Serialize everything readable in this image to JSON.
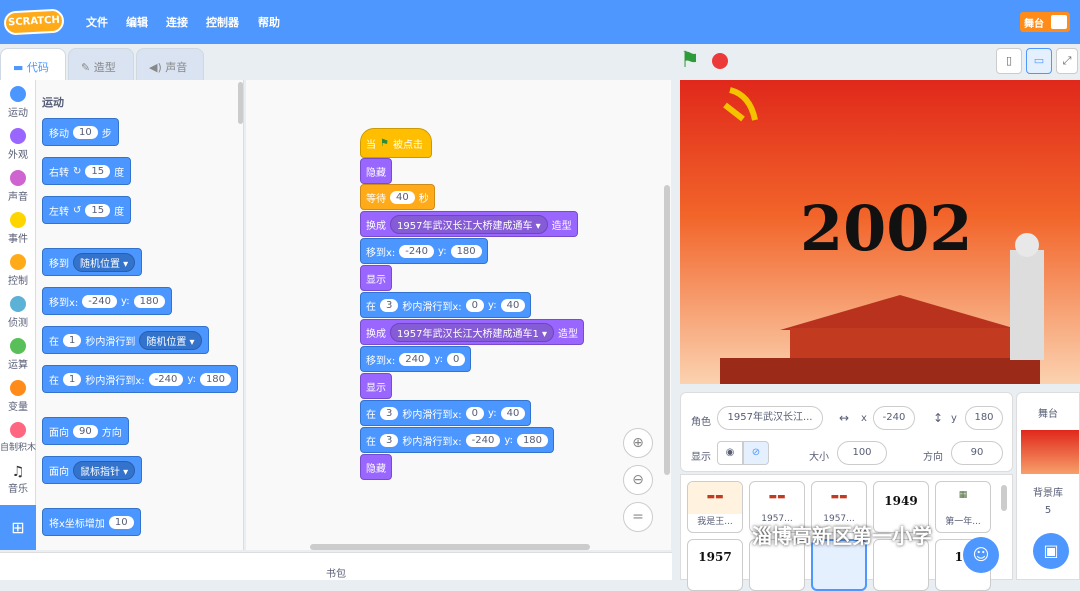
{
  "menu": {
    "logo_text": "SCRATCH",
    "items": [
      "文件",
      "编辑",
      "连接",
      "控制器",
      "帮助"
    ],
    "stage_toggle": "舞台"
  },
  "tabs": [
    "代码",
    "造型",
    "声音"
  ],
  "categories": [
    {
      "label": "运动",
      "color": "#4c97ff"
    },
    {
      "label": "外观",
      "color": "#9966ff"
    },
    {
      "label": "声音",
      "color": "#cf63cf"
    },
    {
      "label": "事件",
      "color": "#ffd500"
    },
    {
      "label": "控制",
      "color": "#ffab19"
    },
    {
      "label": "侦测",
      "color": "#5cb1d6"
    },
    {
      "label": "运算",
      "color": "#59c059"
    },
    {
      "label": "变量",
      "color": "#ff8c1a"
    },
    {
      "label": "自制积木",
      "color": "#ff6680"
    },
    {
      "label": "音乐",
      "color": ""
    }
  ],
  "palette": {
    "heading": "运动",
    "move": {
      "a": "移动",
      "v": "10",
      "b": "步"
    },
    "turn_right": {
      "a": "右转",
      "v": "15",
      "b": "度"
    },
    "turn_left": {
      "a": "左转",
      "v": "15",
      "b": "度"
    },
    "goto": {
      "a": "移到",
      "d": "随机位置"
    },
    "goto_xy": {
      "a": "移到x:",
      "x": "-240",
      "ylab": "y:",
      "y": "180"
    },
    "glide_to": {
      "a": "在",
      "v": "1",
      "b": "秒内滑行到",
      "d": "随机位置"
    },
    "glide_xy": {
      "a": "在",
      "v": "1",
      "b": "秒内滑行到x:",
      "x": "-240",
      "ylab": "y:",
      "y": "180"
    },
    "point_dir": {
      "a": "面向",
      "v": "90",
      "b": "方向"
    },
    "point_towards": {
      "a": "面向",
      "d": "鼠标指针"
    },
    "change_x": {
      "a": "将x坐标增加",
      "v": "10"
    }
  },
  "script": {
    "hat": {
      "a": "当",
      "b": "被点击"
    },
    "hide1": "隐藏",
    "wait": {
      "a": "等待",
      "v": "40",
      "b": "秒"
    },
    "switch1": {
      "a": "换成",
      "d": "1957年武汉长江大桥建成通车",
      "b": "造型"
    },
    "goto1": {
      "a": "移到x:",
      "x": "-240",
      "ylab": "y:",
      "y": "180"
    },
    "show1": "显示",
    "glide1": {
      "a": "在",
      "v": "3",
      "b": "秒内滑行到x:",
      "x": "0",
      "ylab": "y:",
      "y": "40"
    },
    "switch2": {
      "a": "换成",
      "d": "1957年武汉长江大桥建成通车1",
      "b": "造型"
    },
    "goto2": {
      "a": "移到x:",
      "x": "240",
      "ylab": "y:",
      "y": "0"
    },
    "show2": "显示",
    "glide2": {
      "a": "在",
      "v": "3",
      "b": "秒内滑行到x:",
      "x": "0",
      "ylab": "y:",
      "y": "40"
    },
    "glide3": {
      "a": "在",
      "v": "3",
      "b": "秒内滑行到x:",
      "x": "-240",
      "ylab": "y:",
      "y": "180"
    },
    "hide2": "隐藏"
  },
  "backpack": "书包",
  "stage": {
    "year_text": "2002",
    "banner_text": "天安门"
  },
  "sprite_info": {
    "sprite_label": "角色",
    "sprite_name": "1957年武汉长江...",
    "x_label": "x",
    "x": "-240",
    "y_label": "y",
    "y": "180",
    "show_label": "显示",
    "size_label": "大小",
    "size": "100",
    "dir_label": "方向",
    "dir": "90"
  },
  "sprites": [
    {
      "label": "我是王..."
    },
    {
      "label": "1957..."
    },
    {
      "label": "1957..."
    },
    {
      "label": "1949"
    },
    {
      "label": "第一年..."
    },
    {
      "label": "1957"
    },
    {
      "label": ""
    },
    {
      "label": ""
    },
    {
      "label": ""
    },
    {
      "label": "19"
    }
  ],
  "stage_panel": {
    "title": "舞台",
    "backdrop_label": "背景库",
    "count": "5"
  },
  "watermark": "淄博高新区第一小学",
  "colors": {
    "menu": "#4d97ff",
    "motion": "#4c97ff",
    "looks": "#9966ff",
    "control": "#ffab19",
    "events": "#ffbf00"
  }
}
